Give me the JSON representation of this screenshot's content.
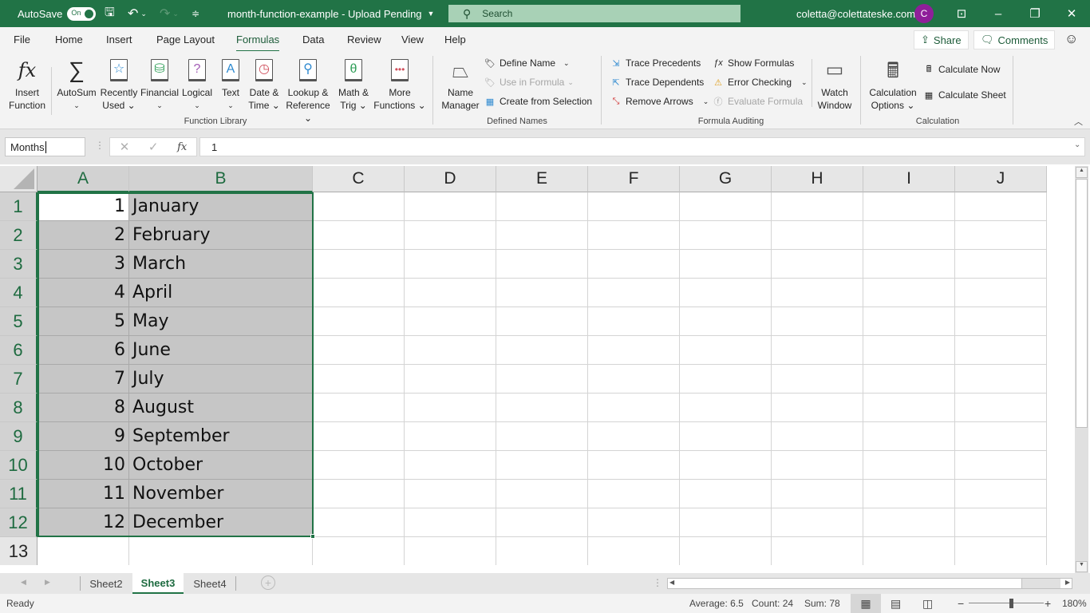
{
  "titlebar": {
    "autosave_label": "AutoSave",
    "autosave_state": "On",
    "document_title": "month-function-example - Upload Pending",
    "search_placeholder": "Search",
    "user_email": "coletta@colettateske.com",
    "avatar_initial": "C",
    "colors": {
      "bar": "#217346",
      "avatar": "#8f1f9a"
    }
  },
  "menu": {
    "tabs": [
      "File",
      "Home",
      "Insert",
      "Page Layout",
      "Formulas",
      "Data",
      "Review",
      "View",
      "Help"
    ],
    "active_tab": "Formulas",
    "share_label": "Share",
    "comments_label": "Comments"
  },
  "ribbon": {
    "function_library": {
      "label": "Function Library",
      "buttons": [
        {
          "line1": "Insert",
          "line2": "Function",
          "icon": "fx-icon"
        },
        {
          "line1": "AutoSum",
          "line2": "⌄",
          "icon": "sigma-icon"
        },
        {
          "line1": "Recently",
          "line2": "Used ⌄",
          "icon": "star-book-icon"
        },
        {
          "line1": "Financial",
          "line2": "⌄",
          "icon": "coins-book-icon"
        },
        {
          "line1": "Logical",
          "line2": "⌄",
          "icon": "question-book-icon"
        },
        {
          "line1": "Text",
          "line2": "⌄",
          "icon": "text-book-icon"
        },
        {
          "line1": "Date &",
          "line2": "Time ⌄",
          "icon": "clock-book-icon"
        },
        {
          "line1": "Lookup &",
          "line2": "Reference ⌄",
          "icon": "magnifier-book-icon"
        },
        {
          "line1": "Math &",
          "line2": "Trig ⌄",
          "icon": "theta-book-icon"
        },
        {
          "line1": "More",
          "line2": "Functions ⌄",
          "icon": "dots-book-icon"
        }
      ]
    },
    "defined_names": {
      "label": "Defined Names",
      "name_manager": {
        "line1": "Name",
        "line2": "Manager"
      },
      "define_name": "Define Name",
      "use_in_formula": "Use in Formula",
      "create_from_selection": "Create from Selection"
    },
    "formula_auditing": {
      "label": "Formula Auditing",
      "trace_precedents": "Trace Precedents",
      "trace_dependents": "Trace Dependents",
      "remove_arrows": "Remove Arrows",
      "show_formulas": "Show Formulas",
      "error_checking": "Error Checking",
      "evaluate_formula": "Evaluate Formula",
      "watch_window": {
        "line1": "Watch",
        "line2": "Window"
      }
    },
    "calculation": {
      "label": "Calculation",
      "options": {
        "line1": "Calculation",
        "line2": "Options ⌄"
      },
      "calculate_now": "Calculate Now",
      "calculate_sheet": "Calculate Sheet"
    }
  },
  "formula_bar": {
    "name_box": "Months",
    "formula_value": "1"
  },
  "sheet": {
    "columns": [
      "A",
      "B",
      "C",
      "D",
      "E",
      "F",
      "G",
      "H",
      "I",
      "J"
    ],
    "rows": [
      {
        "n": "1",
        "a": "1",
        "b": "January"
      },
      {
        "n": "2",
        "a": "2",
        "b": "February"
      },
      {
        "n": "3",
        "a": "3",
        "b": "March"
      },
      {
        "n": "4",
        "a": "4",
        "b": "April"
      },
      {
        "n": "5",
        "a": "5",
        "b": "May"
      },
      {
        "n": "6",
        "a": "6",
        "b": "June"
      },
      {
        "n": "7",
        "a": "7",
        "b": "July"
      },
      {
        "n": "8",
        "a": "8",
        "b": "August"
      },
      {
        "n": "9",
        "a": "9",
        "b": "September"
      },
      {
        "n": "10",
        "a": "10",
        "b": "October"
      },
      {
        "n": "11",
        "a": "11",
        "b": "November"
      },
      {
        "n": "12",
        "a": "12",
        "b": "December"
      },
      {
        "n": "13",
        "a": "",
        "b": ""
      }
    ],
    "selected_range": "A1:B12",
    "active_cell": "A1"
  },
  "sheet_tabs": {
    "tabs": [
      "Sheet2",
      "Sheet3",
      "Sheet4"
    ],
    "active": "Sheet3"
  },
  "status": {
    "mode": "Ready",
    "average": "Average: 6.5",
    "count": "Count: 24",
    "sum": "Sum: 78",
    "zoom": "180%",
    "zoom_minus": "−",
    "zoom_plus": "+"
  }
}
